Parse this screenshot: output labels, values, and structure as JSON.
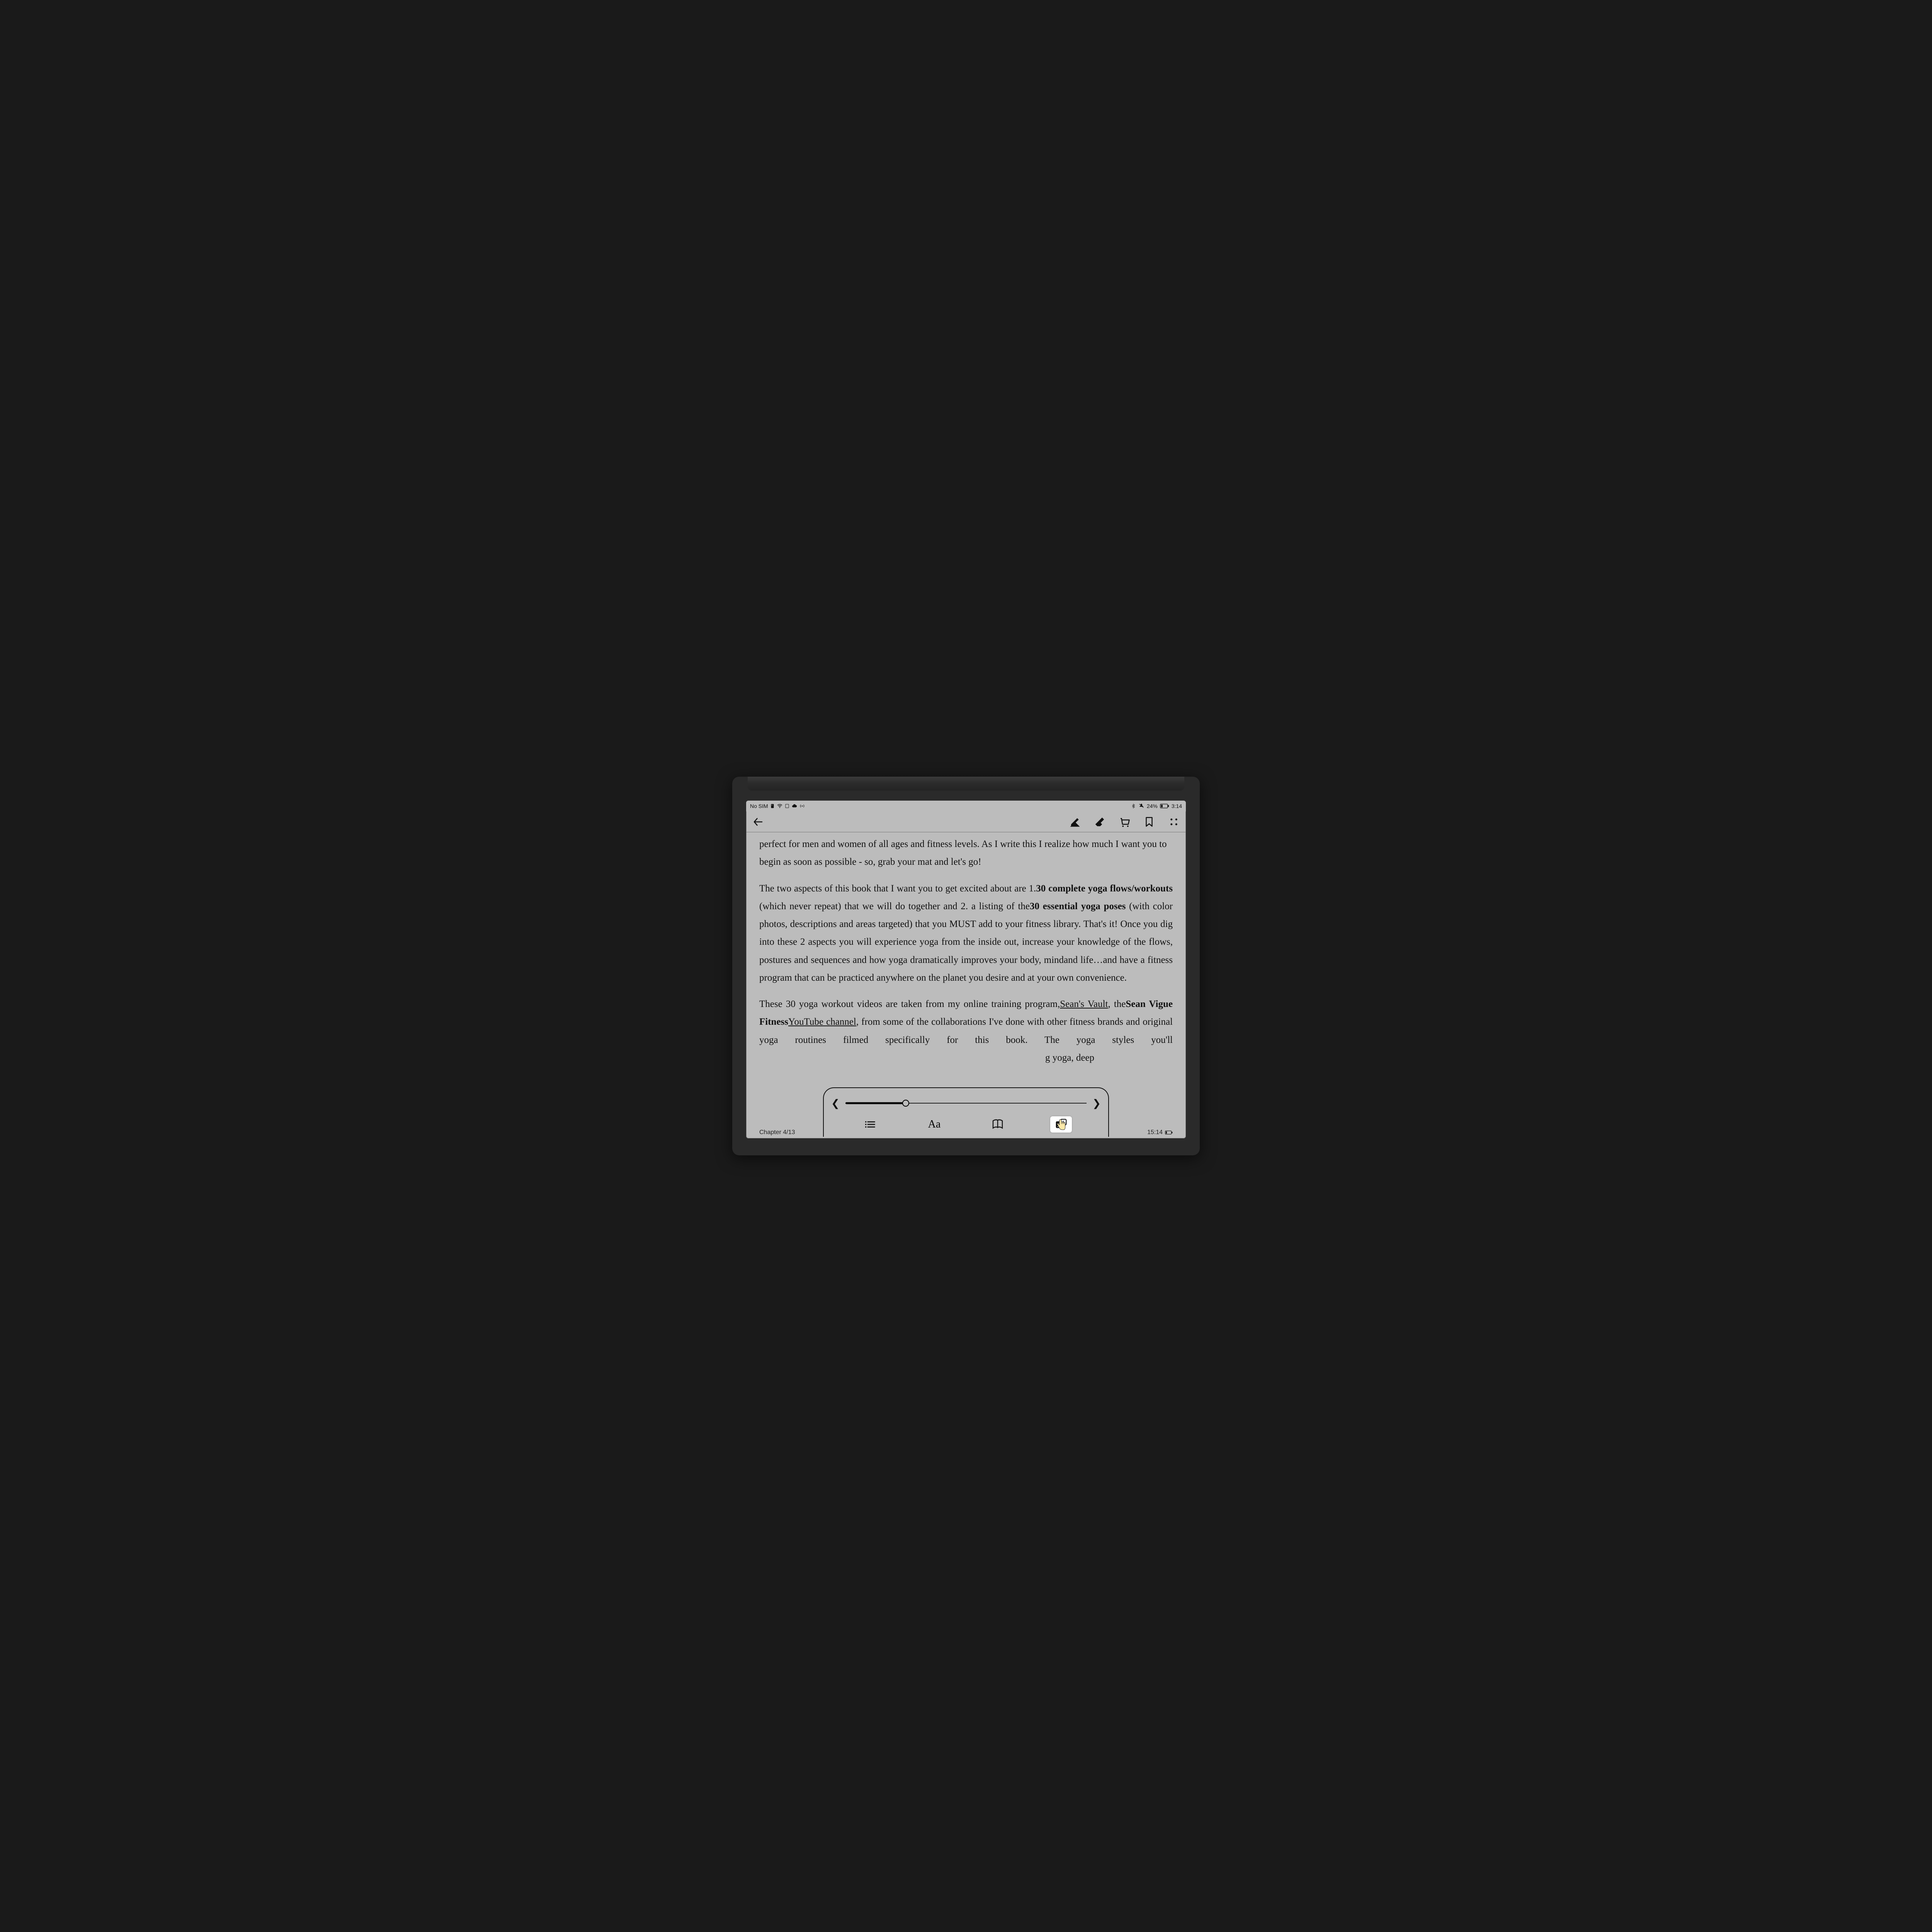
{
  "statusbar": {
    "sim": "No SIM",
    "battery_pct": "24%",
    "time": "3:14"
  },
  "content": {
    "p1": "perfect for men and women of all ages and fitness levels. As I write this I realize how much I want you to begin as soon as possible - so, grab your mat and let's go!",
    "p2_a": "The two aspects of this book that I want you to get excited about are 1.",
    "p2_bold1": "30 complete yoga flows/workouts",
    "p2_b": " (which never repeat) that we will do together and 2. a listing of the",
    "p2_bold2": "30 essential yoga poses",
    "p2_c": " (with color photos, descriptions and areas targeted) that you MUST add to your fitness library. That's it! Once you dig into these 2 aspects you will experience yoga from the inside out, increase your knowledge of the flows, postures and sequences and how yoga dramatically improves your body, mindand life…and have a fitness program that can be practiced anywhere on the planet you desire and at your own convenience.",
    "p3_a": "These 30 yoga workout videos are taken from my online training program,",
    "p3_link1": "Sean's Vault",
    "p3_b": ", the",
    "p3_bold": "Sean Vigue Fitness",
    "p3_link2": "YouTube channel",
    "p3_c": ", from some of the collaborations I've done with other fitness brands and original yoga routines filmed specifically for this book. The yoga styles you'll",
    "p3_gap": "g yoga, deep"
  },
  "footer": {
    "chapter": "Chapter 4/13",
    "progress": "15:14"
  },
  "popup": {
    "font_label": "Aa",
    "slider_pct": 25
  }
}
